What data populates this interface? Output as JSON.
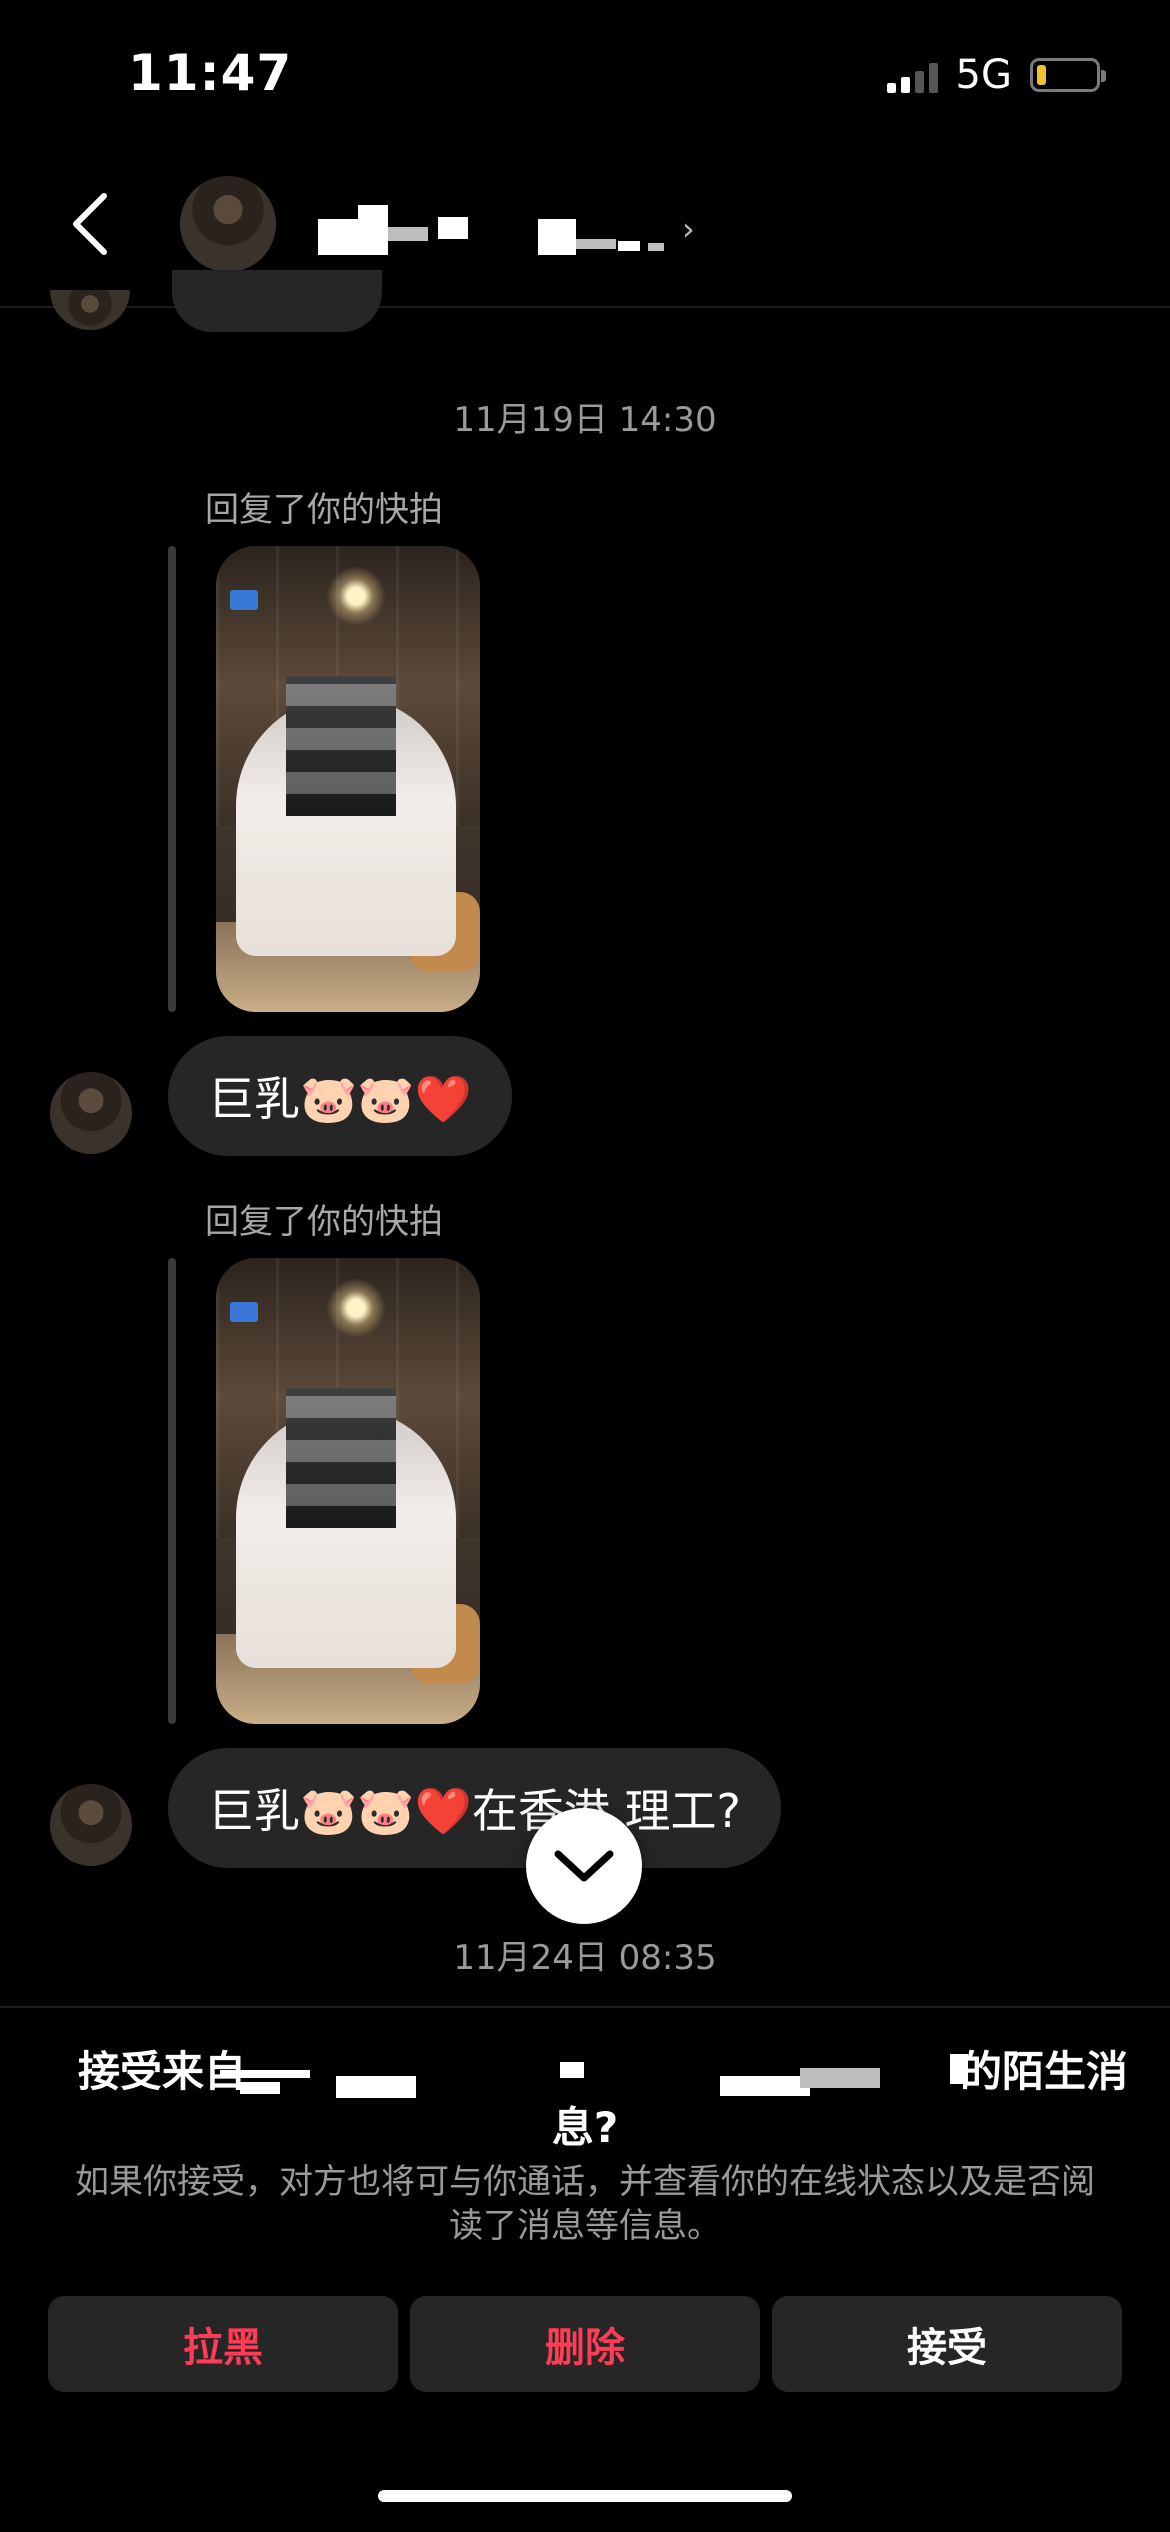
{
  "status_bar": {
    "time": "11:47",
    "network": "5G",
    "battery_level": 0.1
  },
  "header": {
    "contact_name": "",
    "icons": [
      "back-chevron-icon",
      "chevron-right-icon"
    ]
  },
  "chat": {
    "date_1": "11月19日 14:30",
    "reply_label_1": "回复了你的快拍",
    "message_1": "巨乳🐷🐷❤️",
    "reply_label_2": "回复了你的快拍",
    "message_2": "巨乳🐷🐷❤️在香港 理工?",
    "date_2": "11月24日 08:35"
  },
  "request": {
    "title_start": "接受来自",
    "title_end": "的陌生消",
    "title_line2": "息?",
    "description": "如果你接受，对方也将可与你通话，并查看你的在线状态以及是否阅读了消息等信息。",
    "block_label": "拉黑",
    "delete_label": "删除",
    "accept_label": "接受"
  },
  "colors": {
    "background": "#000000",
    "bubble": "#262626",
    "danger": "#ff3b55"
  }
}
